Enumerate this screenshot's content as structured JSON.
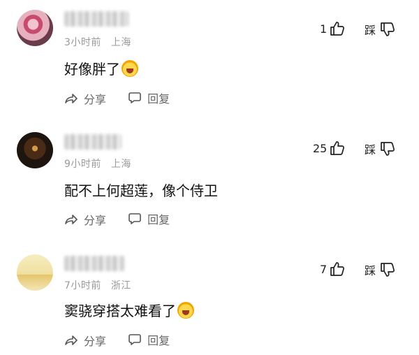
{
  "comments": [
    {
      "time": "3小时前",
      "location": "上海",
      "text": "好像胖了",
      "emoji_icon": "shocked-face-icon",
      "likes": "1",
      "dislike_label": "踩",
      "share_label": "分享",
      "reply_label": "回复"
    },
    {
      "time": "9小时前",
      "location": "上海",
      "text": "配不上何超莲，像个侍卫",
      "emoji_icon": "",
      "likes": "25",
      "dislike_label": "踩",
      "share_label": "分享",
      "reply_label": "回复"
    },
    {
      "time": "7小时前",
      "location": "浙江",
      "text": "窦骁穿搭太难看了",
      "emoji_icon": "crying-laughing-face-icon",
      "likes": "7",
      "dislike_label": "踩",
      "share_label": "分享",
      "reply_label": "回复"
    }
  ]
}
